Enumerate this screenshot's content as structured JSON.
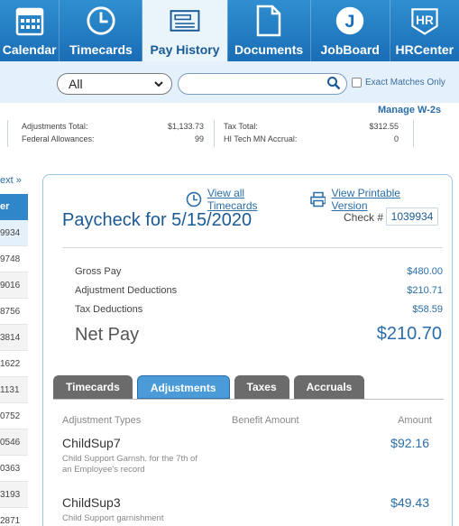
{
  "nav": {
    "items": [
      {
        "label": "Calendar",
        "icon": "calendar-icon"
      },
      {
        "label": "Timecards",
        "icon": "clock-icon"
      },
      {
        "label": "Pay History",
        "icon": "pay-stub-icon"
      },
      {
        "label": "Documents",
        "icon": "document-icon"
      },
      {
        "label": "JobBoard",
        "icon": "jobboard-icon"
      },
      {
        "label": "HRCenter",
        "icon": "hr-icon"
      }
    ],
    "active_index": 2,
    "hr_icon_text": "HR",
    "jb_icon_text": "J"
  },
  "filter": {
    "select_value": "All",
    "search_value": "",
    "exact_label": "Exact Matches Only"
  },
  "summary": {
    "manage_link": "Manage W-2s",
    "left": [
      {
        "label": "Adjustments Total:",
        "value": "$1,133.73"
      },
      {
        "label": "Federal Allowances:",
        "value": "99"
      }
    ],
    "right": [
      {
        "label": "Tax Total:",
        "value": "$312.55"
      },
      {
        "label": "HI Tech MN Accrual:",
        "value": "0"
      }
    ]
  },
  "leftlist": {
    "next_link": "ext »",
    "header": "er",
    "rows": [
      "9934",
      "9748",
      "9016",
      "8756",
      "3814",
      "1622",
      "1131",
      "0752",
      "0546",
      "0363",
      "3193",
      "2871"
    ]
  },
  "paycheck": {
    "view_timecards": "View all Timecards",
    "view_printable": "View Printable Version",
    "title": "Paycheck for 5/15/2020",
    "check_label": "Check #",
    "check_number": "1039934",
    "rows": [
      {
        "label": "Gross Pay",
        "value": "$480.00"
      },
      {
        "label": "Adjustment Deductions",
        "value": "$210.71"
      },
      {
        "label": "Tax Deductions",
        "value": "$58.59"
      }
    ],
    "net_label": "Net Pay",
    "net_value": "$210.70"
  },
  "tabs": {
    "items": [
      "Timecards",
      "Adjustments",
      "Taxes",
      "Accruals"
    ],
    "active_index": 1
  },
  "adjustments": {
    "headers": {
      "type": "Adjustment Types",
      "benefit": "Benefit Amount",
      "amount": "Amount"
    },
    "items": [
      {
        "name": "ChildSup7",
        "desc": "Child Support Garnsh. for the 7th of an Employee's record",
        "amount": "$92.16"
      },
      {
        "name": "ChildSup3",
        "desc": "Child Support garnishment",
        "amount": "$49.43"
      }
    ]
  },
  "colors": {
    "nav_bg": "#1a6db6",
    "accent": "#2a6da8",
    "active_tab": "#4a9bd8",
    "tab_bg": "#6b6b6b"
  }
}
